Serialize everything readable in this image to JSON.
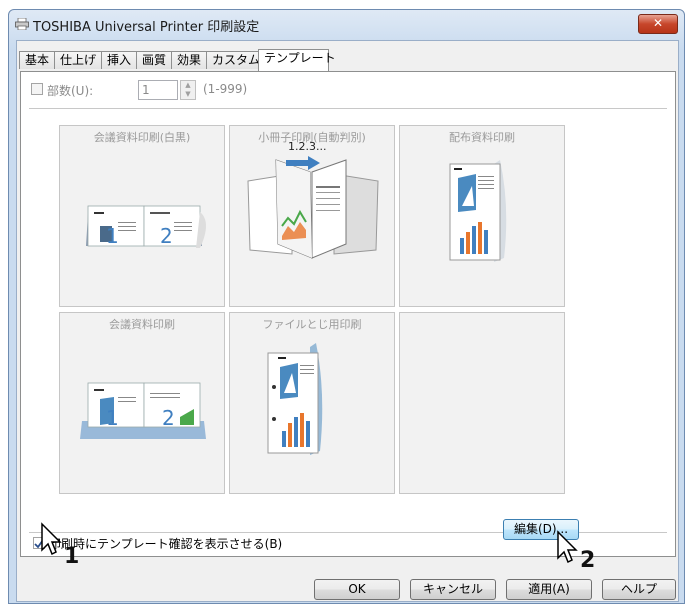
{
  "window": {
    "title": "TOSHIBA Universal Printer 印刷設定",
    "close_label": "✕"
  },
  "tabs": [
    {
      "label": "基本"
    },
    {
      "label": "仕上げ"
    },
    {
      "label": "挿入"
    },
    {
      "label": "画質"
    },
    {
      "label": "効果"
    },
    {
      "label": "カスタム"
    },
    {
      "label": "テンプレート",
      "active": true
    }
  ],
  "copies": {
    "label": "部数(U):",
    "value": "1",
    "range": "(1-999)"
  },
  "templates": [
    {
      "label": "会議資料印刷(白黒)"
    },
    {
      "label": "小冊子印刷(自動判別)",
      "caption": "1.2.3..."
    },
    {
      "label": "配布資料印刷"
    },
    {
      "label": "会議資料印刷"
    },
    {
      "label": "ファイルとじ用印刷"
    },
    {
      "label": ""
    }
  ],
  "confirm_checkbox": {
    "label": "印刷時にテンプレート確認を表示させる(B)",
    "checked": true
  },
  "edit_button": {
    "label": "編集(D)..."
  },
  "footer_buttons": {
    "ok": "OK",
    "cancel": "キャンセル",
    "apply": "適用(A)",
    "help": "ヘルプ"
  },
  "annotations": {
    "step1": "1",
    "step2": "2"
  },
  "colors": {
    "accent_blue": "#3f7fc0",
    "chart_orange": "#e8762c",
    "chart_green": "#4aa84a",
    "close_red": "#c7462b"
  }
}
